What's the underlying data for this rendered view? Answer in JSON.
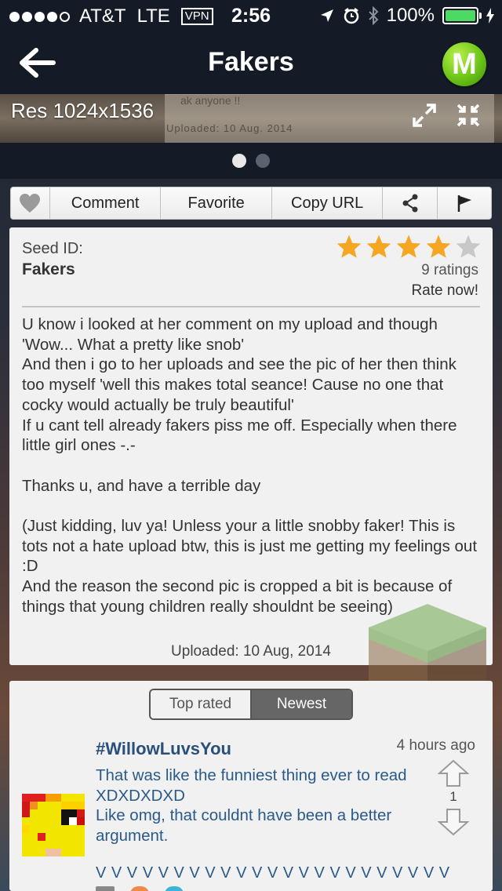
{
  "status_bar": {
    "carrier": "AT&T",
    "network": "LTE",
    "vpn": "VPN",
    "time": "2:56",
    "battery": "100%"
  },
  "nav": {
    "title": "Fakers",
    "logo_letter": "M"
  },
  "image_viewer": {
    "resolution": "Res 1024x1536",
    "ghost_line1": "ak anyone !!",
    "ghost_line2": "Uploaded: 10 Aug. 2014",
    "page_count": 2,
    "active_page": 1
  },
  "actions": {
    "comment": "Comment",
    "favorite": "Favorite",
    "copy_url": "Copy URL"
  },
  "seed": {
    "id_label": "Seed ID:",
    "name": "Fakers",
    "rating_stars": 4,
    "max_stars": 5,
    "ratings_count": "9 ratings",
    "rate_now": "Rate now!",
    "description": "U know i looked at her comment on my upload and though 'Wow... What a pretty like snob'\nAnd then i go to her uploads and see the pic of her then think too myself 'well this makes total seance! Cause no one that cocky would actually be truly beautiful'\nIf u cant tell already fakers piss me off. Especially when there little girl ones -.-\n\nThanks u, and have a terrible day\n\n(Just kidding, luv ya! Unless your a little snobby faker! This is tots not a hate upload btw, this is just me getting my feelings out :D\nAnd the reason the second pic is cropped a bit is because of things that young children really shouldnt be seeing)",
    "uploaded": "Uploaded: 10 Aug, 2014"
  },
  "comments": {
    "tabs": [
      "Top rated",
      "Newest"
    ],
    "active_tab": "Newest",
    "items": [
      {
        "user": "#WillowLuvsYou",
        "time": "4 hours ago",
        "text": "That was like the funniest thing ever to read XDXDXDXD\nLike omg, that couldnt have been a better argument.",
        "votes": "1",
        "tail": "V V V V V V V V V V V V V V V V V V V V V V V"
      }
    ]
  },
  "colors": {
    "bar_bg": "#141b26",
    "star_on": "#f5a623",
    "star_off": "#c8c8c8",
    "logo_green": "#6cc417",
    "battery_green": "#4cd964",
    "comment_blue": "#2a5a8a"
  }
}
